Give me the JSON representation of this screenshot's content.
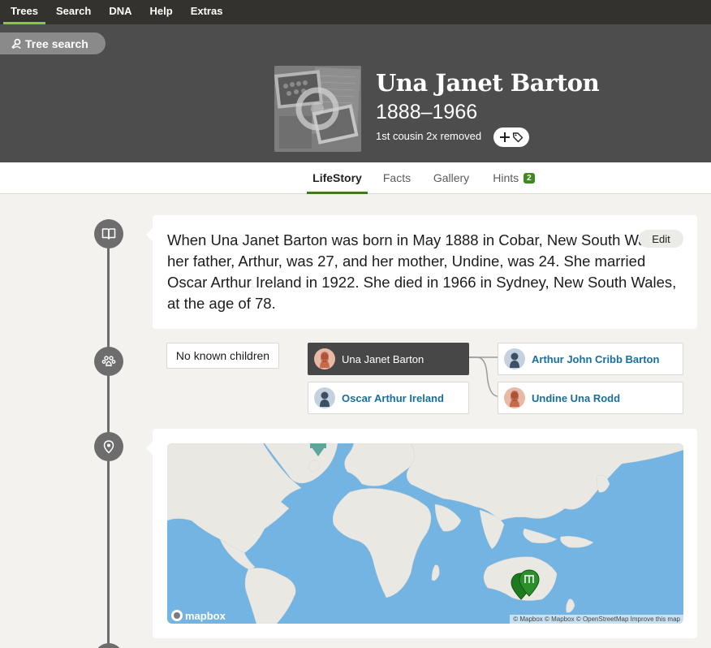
{
  "nav": {
    "items": [
      {
        "label": "Trees",
        "active": true
      },
      {
        "label": "Search"
      },
      {
        "label": "DNA"
      },
      {
        "label": "Help"
      },
      {
        "label": "Extras"
      }
    ]
  },
  "header": {
    "tree_search_label": "Tree search",
    "name": "Una Janet Barton",
    "dates": "1888–1966",
    "relationship": "1st cousin 2x removed"
  },
  "tabs": [
    {
      "label": "LifeStory",
      "active": true
    },
    {
      "label": "Facts"
    },
    {
      "label": "Gallery"
    },
    {
      "label": "Hints",
      "badge": "2"
    }
  ],
  "story": {
    "text": "When Una Janet Barton was born in May 1888 in Cobar, New South Wales, her father, Arthur, was 27, and her mother, Undine, was 24. She married Oscar Arthur Ireland in 1922. She died in 1966 in Sydney, New South Wales, at the age of 78.",
    "edit_label": "Edit"
  },
  "family": {
    "no_children_label": "No known children",
    "self": {
      "name": "Una Janet Barton",
      "gender": "female"
    },
    "spouse": {
      "name": "Oscar Arthur Ireland",
      "gender": "male"
    },
    "father": {
      "name": "Arthur John Cribb Barton",
      "gender": "male"
    },
    "mother": {
      "name": "Undine Una Rodd",
      "gender": "female"
    }
  },
  "map": {
    "logo_label": "mapbox",
    "attribution": "© Mapbox © Mapbox © OpenStreetMap Improve this map"
  },
  "colors": {
    "nav_bg": "#33322f",
    "header_bg": "#4d4d4d",
    "accent_green": "#3f7a1e",
    "link_blue": "#1a6e9e",
    "ocean": "#74b4e2",
    "land": "#e9e8e3"
  },
  "icons": [
    "search-person-icon",
    "plus-icon",
    "tag-icon",
    "book-icon",
    "paw-family-icon",
    "location-pin-icon",
    "map-marker-icon"
  ]
}
